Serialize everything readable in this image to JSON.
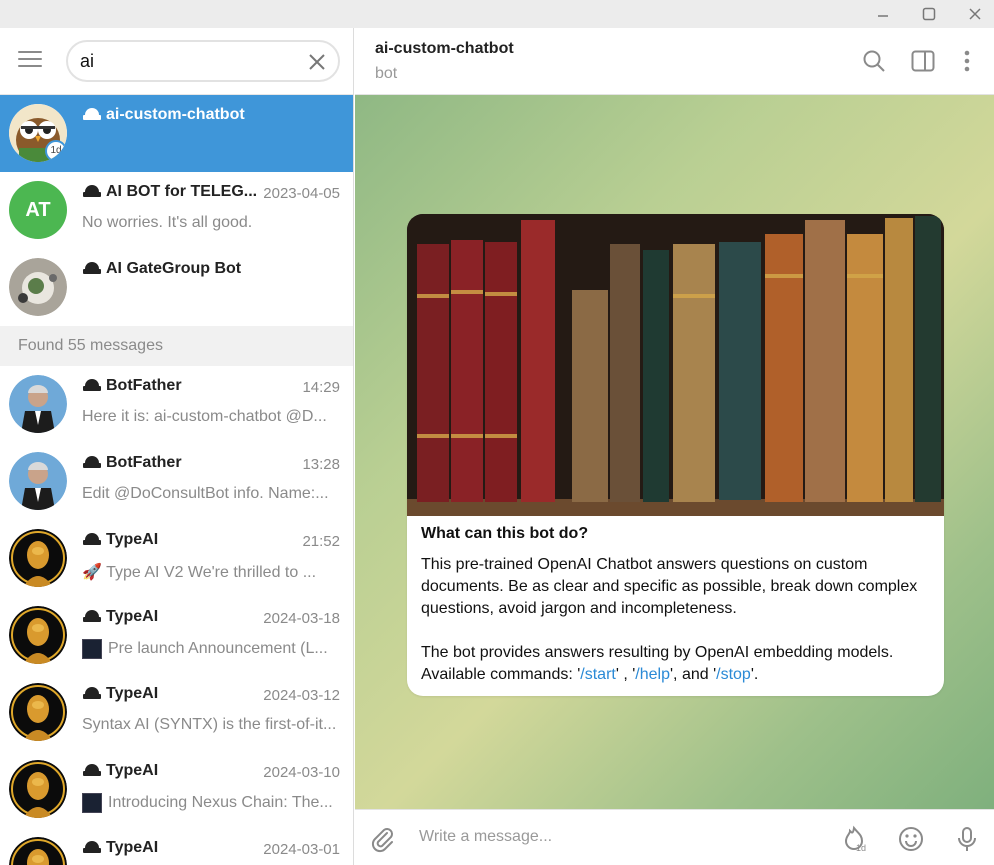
{
  "window": {
    "controls": [
      "minimize-icon",
      "maximize-icon",
      "close-icon"
    ]
  },
  "search": {
    "value": "ai"
  },
  "top_results": [
    {
      "name": "ai-custom-chatbot",
      "date": "",
      "snippet": "",
      "badge": "1d",
      "active": true,
      "avatar": "owl"
    },
    {
      "name": "AI BOT for TELEG...",
      "date": "2023-04-05",
      "snippet": "No worries. It's all good.",
      "avatar_initials": "AT",
      "avatar_color": "#4cb751"
    },
    {
      "name": "AI GateGroup Bot",
      "date": "",
      "snippet": "",
      "avatar": "photo"
    }
  ],
  "found_label": "Found 55 messages",
  "messages": [
    {
      "name": "BotFather",
      "date": "14:29",
      "snippet": "Here it is: ai-custom-chatbot @D...",
      "avatar": "botfather"
    },
    {
      "name": "BotFather",
      "date": "13:28",
      "snippet": "Edit @DoConsultBot info.  Name:...",
      "avatar": "botfather"
    },
    {
      "name": "TypeAI",
      "date": "21:52",
      "snippet": "🚀 Type AI V2   We're thrilled to ...",
      "avatar": "typeai"
    },
    {
      "name": "TypeAI",
      "date": "2024-03-18",
      "snippet": "Pre launch Announcement (L...",
      "avatar": "typeai",
      "thumb": true
    },
    {
      "name": "TypeAI",
      "date": "2024-03-12",
      "snippet": "Syntax AI (SYNTX) is the first-of-it...",
      "avatar": "typeai"
    },
    {
      "name": "TypeAI",
      "date": "2024-03-10",
      "snippet": "Introducing Nexus Chain: The...",
      "avatar": "typeai",
      "thumb": true
    },
    {
      "name": "TypeAI",
      "date": "2024-03-01",
      "snippet": "",
      "avatar": "typeai"
    }
  ],
  "chat": {
    "title": "ai-custom-chatbot",
    "subtitle": "bot",
    "card": {
      "heading": "What can this bot do?",
      "para1": "This pre-trained OpenAI Chatbot answers questions on custom documents. Be as clear and specific as possible, break down complex questions, avoid jargon and incompleteness.",
      "para2_text": "The bot provides answers resulting by OpenAI embedding models. Available commands: '",
      "cmd_start": "/start",
      "sep1": "' , '",
      "cmd_help": "/help",
      "sep2": "', and '",
      "cmd_stop": "/stop",
      "end": "'."
    },
    "composer_placeholder": "Write a message...",
    "timer_badge": "1d"
  },
  "colors": {
    "active": "#3f96d9",
    "accent": "#2b8ad6"
  }
}
